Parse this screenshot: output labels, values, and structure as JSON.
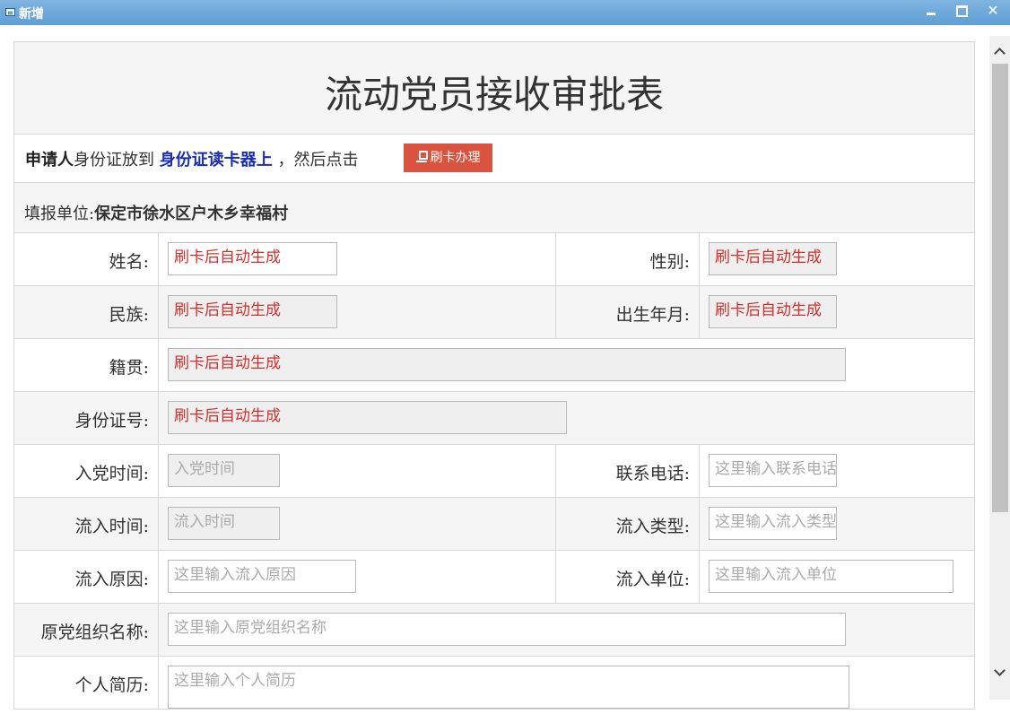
{
  "window": {
    "title": "新增"
  },
  "form": {
    "title": "流动党员接收审批表",
    "instruction": {
      "applicant": "申请人",
      "text1": "身份证放到",
      "highlight": "身份证读卡器上",
      "text2": "，然后点击",
      "button": "刷卡办理"
    },
    "unit": {
      "label": "填报单位:",
      "value": "保定市徐水区户木乡幸福村"
    },
    "fields": {
      "name": {
        "label": "姓名:",
        "value": "刷卡后自动生成"
      },
      "gender": {
        "label": "性别:",
        "value": "刷卡后自动生成"
      },
      "ethnicity": {
        "label": "民族:",
        "value": "刷卡后自动生成"
      },
      "birth": {
        "label": "出生年月:",
        "value": "刷卡后自动生成"
      },
      "hometown": {
        "label": "籍贯:",
        "value": "刷卡后自动生成"
      },
      "id_number": {
        "label": "身份证号:",
        "value": "刷卡后自动生成"
      },
      "join_date": {
        "label": "入党时间:",
        "placeholder": "入党时间"
      },
      "phone": {
        "label": "联系电话:",
        "placeholder": "这里输入联系电话"
      },
      "inflow_date": {
        "label": "流入时间:",
        "placeholder": "流入时间"
      },
      "inflow_type": {
        "label": "流入类型:",
        "placeholder": "这里输入流入类型"
      },
      "inflow_reason": {
        "label": "流入原因:",
        "placeholder": "这里输入流入原因"
      },
      "inflow_unit": {
        "label": "流入单位:",
        "placeholder": "这里输入流入单位"
      },
      "orig_org": {
        "label": "原党组织名称:",
        "placeholder": "这里输入原党组织名称"
      },
      "resume": {
        "label": "个人简历:",
        "placeholder": "这里输入个人简历"
      }
    }
  }
}
